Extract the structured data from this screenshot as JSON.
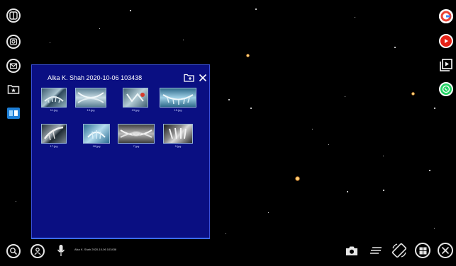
{
  "panel": {
    "title": "Alka K. Shah 2020-10-06 103438",
    "thumbnails": [
      {
        "label": "11.jpg",
        "icon": "xray-icon"
      },
      {
        "label": "13.jpg",
        "icon": "xray-icon"
      },
      {
        "label": "13.jpg",
        "icon": "xray-icon"
      },
      {
        "label": "15.jpg",
        "icon": "xray-icon"
      },
      {
        "label": "17.jpg",
        "icon": "xray-icon"
      },
      {
        "label": "18.jpg",
        "icon": "xray-icon"
      },
      {
        "label": "7.jpg",
        "icon": "panoramic-xray-icon"
      },
      {
        "label": "9.jpg",
        "icon": "xray-icon"
      }
    ]
  },
  "left_toolbar": [
    {
      "name": "layout-icon"
    },
    {
      "name": "camera-search-icon"
    },
    {
      "name": "mail-icon"
    },
    {
      "name": "folder-star-icon"
    },
    {
      "name": "3d-view-icon"
    }
  ],
  "right_toolbar": [
    {
      "name": "google-icon",
      "color": "#e94235"
    },
    {
      "name": "youtube-icon",
      "color": "#e62117"
    },
    {
      "name": "video-library-icon",
      "color": "#ffffff"
    },
    {
      "name": "whatsapp-icon",
      "color": "#25d366"
    }
  ],
  "bottom_bar": {
    "caption": "Alka K. Shah 2020-10-06 103438",
    "left_icons": [
      "search-icon",
      "user-icon",
      "microphone-icon"
    ],
    "right_icons": [
      "camera-icon",
      "menu-icon",
      "rotate-icon",
      "windows-icon",
      "close-icon"
    ]
  },
  "colors": {
    "panel_background": "#0a0f82",
    "panel_accent": "#3c6cff",
    "background": "#000000"
  }
}
